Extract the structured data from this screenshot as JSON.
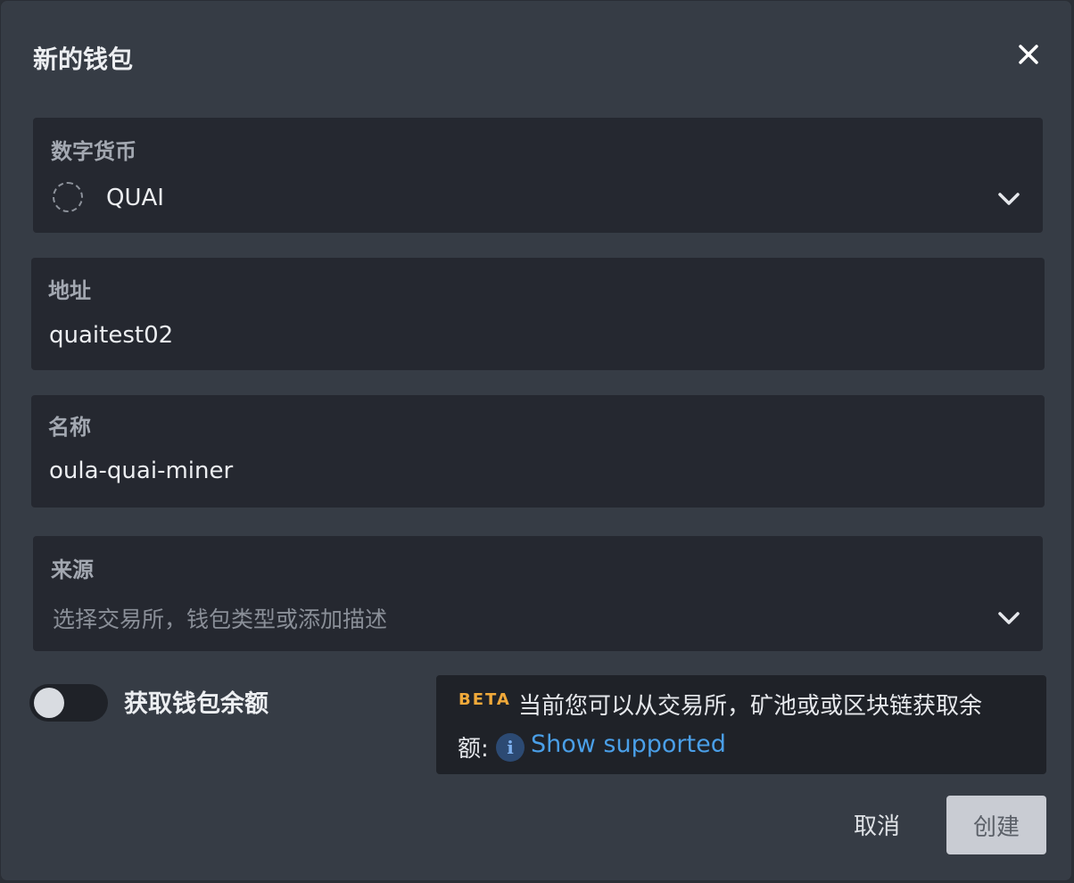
{
  "dialog": {
    "title": "新的钱包",
    "close_icon": "close-icon"
  },
  "currency": {
    "label": "数字货币",
    "value": "QUAI",
    "icon": "coin-placeholder-icon"
  },
  "address": {
    "label": "地址",
    "value": "quaitest02"
  },
  "name": {
    "label": "名称",
    "value": "oula-quai-miner"
  },
  "source": {
    "label": "来源",
    "placeholder": "选择交易所，钱包类型或添加描述"
  },
  "balance_toggle": {
    "label": "获取钱包余额",
    "enabled": false
  },
  "beta_notice": {
    "tag": "BETA",
    "text_line1": "当前您可以从交易所，矿池或或区块链获取余",
    "text_line2": "额:",
    "info_icon": "i",
    "link": "Show supported"
  },
  "buttons": {
    "cancel": "取消",
    "create": "创建"
  },
  "colors": {
    "dialog_bg": "#363c45",
    "field_bg": "#252830",
    "beta_tag": "#f0a93a",
    "link": "#4a9fe8",
    "create_button_bg": "#c9ccd3"
  }
}
